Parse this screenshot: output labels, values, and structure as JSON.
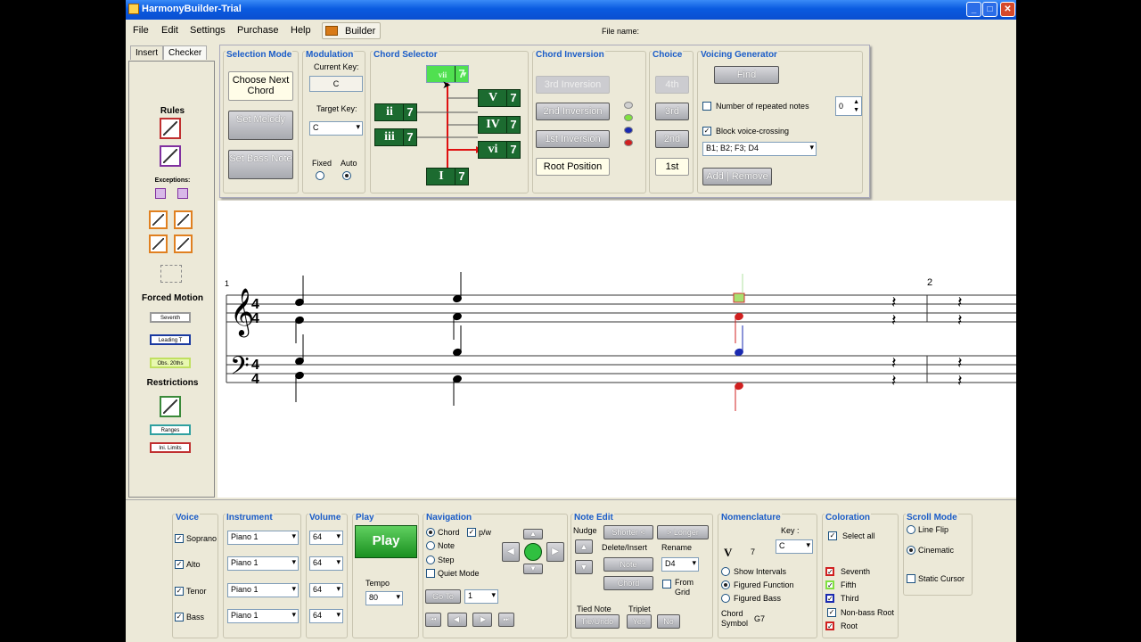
{
  "window": {
    "title": "HarmonyBuilder-Trial"
  },
  "menu": {
    "items": [
      "File",
      "Edit",
      "Settings",
      "Purchase",
      "Help"
    ],
    "builder": "Builder",
    "file_name_label": "File name:"
  },
  "tabs": [
    "Insert",
    "Checker"
  ],
  "left_panel": {
    "rules": "Rules",
    "exceptions": "Exceptions:",
    "forced_motion": "Forced Motion",
    "fm_labels": [
      "Seventh",
      "Leading T",
      "Obs. 20ths"
    ],
    "restrictions": "Restrictions",
    "r_labels": [
      "Ranges",
      "Ini. Limits"
    ]
  },
  "selection_mode": {
    "title": "Selection Mode",
    "choose": "Choose Next Chord",
    "melody": "Set Melody",
    "bass": "Set Bass Note"
  },
  "modulation": {
    "title": "Modulation",
    "current_key_label": "Current Key:",
    "current_key": "C",
    "target_key_label": "Target Key:",
    "target_key": "C",
    "fixed": "Fixed",
    "auto": "Auto"
  },
  "chord_selector": {
    "title": "Chord Selector",
    "chords": [
      "vii",
      "V",
      "ii",
      "IV",
      "iii",
      "vi",
      "I"
    ],
    "seventh": "7"
  },
  "chord_inversion": {
    "title": "Chord Inversion",
    "third": "3rd Inversion",
    "second": "2nd Inversion",
    "first": "1st Inversion",
    "root": "Root Position"
  },
  "choice": {
    "title": "Choice",
    "opts": [
      "4th",
      "3rd",
      "2nd",
      "1st"
    ]
  },
  "voicing": {
    "title": "Voicing Generator",
    "find": "Find",
    "repeated": "Number of repeated notes",
    "repeated_val": "0",
    "block": "Block voice-crossing",
    "voicing_sel": "B1; B2; F3; D4",
    "add_remove": "Add | Remove"
  },
  "score": {
    "measures": [
      "1",
      "2"
    ]
  },
  "voice": {
    "title": "Voice",
    "items": [
      "Soprano",
      "Alto",
      "Tenor",
      "Bass"
    ]
  },
  "instrument": {
    "title": "Instrument",
    "items": [
      "Piano 1",
      "Piano 1",
      "Piano 1",
      "Piano 1"
    ]
  },
  "volume": {
    "title": "Volume",
    "items": [
      "64",
      "64",
      "64",
      "64"
    ]
  },
  "play": {
    "title": "Play",
    "button": "Play",
    "tempo_label": "Tempo",
    "tempo": "80"
  },
  "navigation": {
    "title": "Navigation",
    "chord": "Chord",
    "pw": "p/w",
    "note": "Note",
    "step": "Step",
    "quiet": "Quiet Mode",
    "goto": "Go To",
    "goto_val": "1"
  },
  "note_edit": {
    "title": "Note Edit",
    "nudge": "Nudge",
    "shorter": "Shorter <",
    "longer": "> Longer",
    "delete_insert": "Delete/Insert",
    "rename": "Rename",
    "note_btn": "Note",
    "rename_val": "D4",
    "chord_btn": "Chord",
    "from_grid": "From Grid",
    "tied": "Tied Note",
    "tie_undo": "Tie/Undo",
    "triplet": "Triplet",
    "yes": "Yes",
    "no": "No"
  },
  "nomenclature": {
    "title": "Nomenclature",
    "key_label": "Key :",
    "key": "C",
    "roman": "V",
    "figure": "7",
    "intervals": "Show Intervals",
    "fig_func": "Figured Function",
    "fig_bass": "Figured Bass",
    "chord_symbol_label": "Chord Symbol",
    "chord_symbol": "G7"
  },
  "coloration": {
    "title": "Coloration",
    "select_all": "Select all",
    "items": [
      "Seventh",
      "Fifth",
      "Third",
      "Non-bass Root",
      "Root"
    ]
  },
  "scroll": {
    "title": "Scroll Mode",
    "line_flip": "Line Flip",
    "cinematic": "Cinematic",
    "static": "Static Cursor"
  },
  "colors": {
    "title_bar": "#0a5be0",
    "chord_green": "#1c6b30",
    "group_title": "#1a5cc8"
  }
}
